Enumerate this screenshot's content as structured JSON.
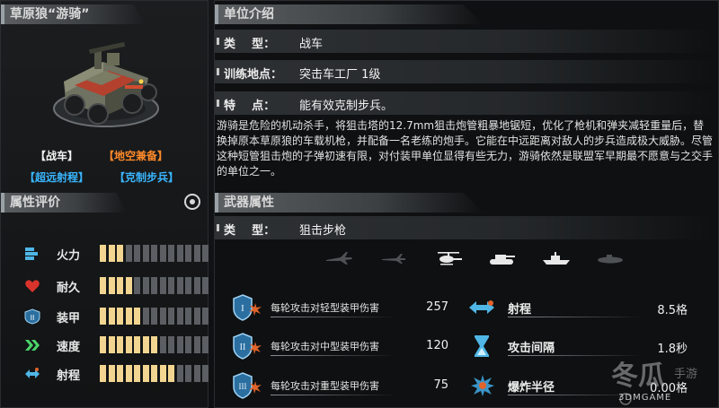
{
  "left": {
    "title": "草原狼“游骑”",
    "tags": {
      "type": "【战车】",
      "ability1": "【地空兼备】",
      "ability2": "【超远射程】",
      "ability3": "【克制步兵】"
    },
    "rating_title": "属性评价",
    "stats": [
      {
        "label": "火力",
        "level": 3,
        "max": 13,
        "icon": "firepower-icon"
      },
      {
        "label": "耐久",
        "level": 4,
        "max": 13,
        "icon": "heart-icon"
      },
      {
        "label": "装甲",
        "level": 5,
        "max": 13,
        "icon": "armor-icon"
      },
      {
        "label": "速度",
        "level": 7,
        "max": 13,
        "icon": "speed-chevrons-icon"
      },
      {
        "label": "射程",
        "level": 9,
        "max": 13,
        "icon": "range-arrows-icon"
      }
    ]
  },
  "unit_info": {
    "title": "单位介绍",
    "rows": [
      {
        "key": "类    型：",
        "value": "战车"
      },
      {
        "key": "训练地点：",
        "value": "突击车工厂 1级"
      },
      {
        "key": "特    点：",
        "value": "能有效克制步兵。"
      }
    ],
    "description": "游骑是危险的机动杀手，将狙击塔的12.7mm狙击炮管粗暴地锯短，优化了枪机和弹夹减轻重量后，替换掉原本草原狼的车载机枪，并配备一名老练的炮手。它能在中远距离对敌人的步兵造成极大威胁。尽管这种短管狙击炮的子弹初速有限，对付装甲单位显得有些无力，游骑依然是联盟军早期最不愿意与之交手的单位之一。"
  },
  "weapon": {
    "title": "武器属性",
    "type_key": "类    型：",
    "type_value": "狙击步枪",
    "targets": [
      {
        "name": "jet-icon",
        "active": false
      },
      {
        "name": "plane-icon",
        "active": false
      },
      {
        "name": "helicopter-icon",
        "active": true
      },
      {
        "name": "tank-icon",
        "active": true
      },
      {
        "name": "ship-icon",
        "active": true
      },
      {
        "name": "submarine-icon",
        "active": false
      }
    ],
    "damage": [
      {
        "label": "每轮攻击对轻型装甲伤害",
        "value": "257",
        "tier": "I"
      },
      {
        "label": "每轮攻击对中型装甲伤害",
        "value": "120",
        "tier": "II"
      },
      {
        "label": "每轮攻击对重型装甲伤害",
        "value": "75",
        "tier": "III"
      }
    ],
    "specs": [
      {
        "label": "射程",
        "value": "8.5格"
      },
      {
        "label": "攻击间隔",
        "value": "1.8秒"
      },
      {
        "label": "爆炸半径",
        "value": "0.00格"
      }
    ]
  },
  "watermark": {
    "brand": "冬瓜手游",
    "site": "3DMGAME"
  },
  "colors": {
    "accent_orange": "#ff8a2a",
    "accent_blue": "#39b6ff",
    "bar_on": "#f1d590",
    "bar_off": "#5b5f63"
  }
}
